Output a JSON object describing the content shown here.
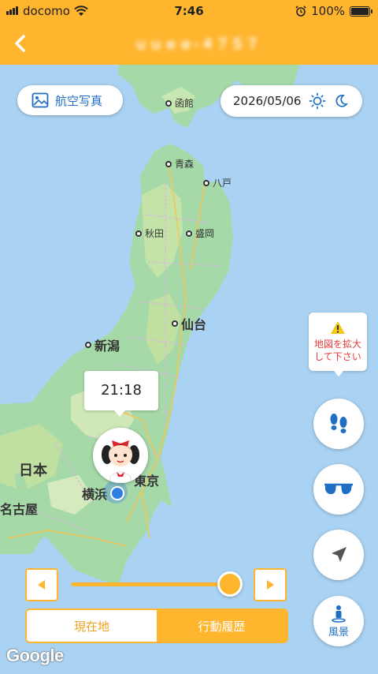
{
  "status": {
    "carrier": "docomo",
    "time": "7:46",
    "battery": "100%"
  },
  "nav": {
    "title": "ｕｕｅｅ-４７５７"
  },
  "map": {
    "aerial_label": "航空写真",
    "date": "2026/05/06",
    "cities": {
      "hakodate": "函館",
      "aomori": "青森",
      "hachinohe": "八戸",
      "akita": "秋田",
      "morioka": "盛岡",
      "sendai": "仙台",
      "niigata": "新潟",
      "tokyo": "東京",
      "yokohama": "横浜",
      "nagoya": "名古屋",
      "japan": "日本"
    },
    "warning": {
      "line1": "地図を拡大",
      "line2": "して下さい"
    },
    "time_tip": "21:18"
  },
  "right_buttons": {
    "scenery_label": "風景"
  },
  "segments": {
    "current": "現在地",
    "history": "行動履歴"
  },
  "google": "Google",
  "colors": {
    "accent": "#ffb52e",
    "link": "#1f6fc4",
    "warning": "#e23b3b"
  }
}
